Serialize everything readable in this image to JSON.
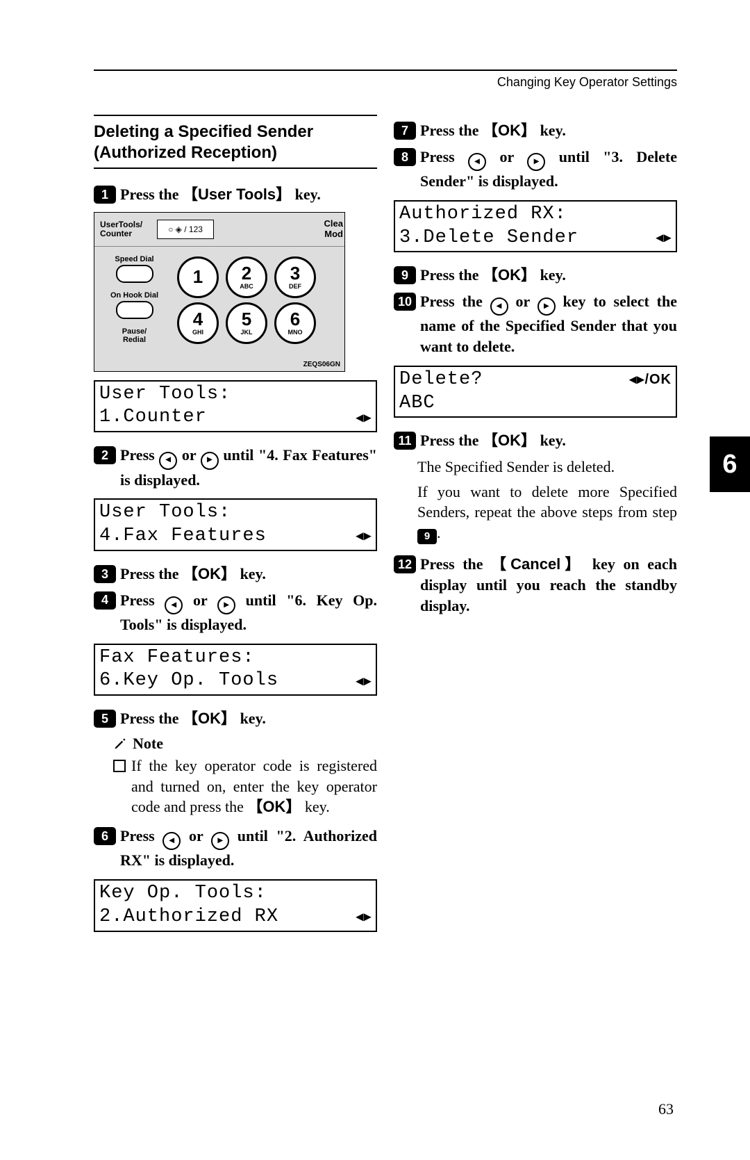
{
  "header": "Changing Key Operator Settings",
  "section_title": "Deleting a Specified Sender (Authorized Reception)",
  "page_number": "63",
  "tab_number": "6",
  "keys": {
    "user_tools": "User Tools",
    "ok": "OK",
    "cancel": "Cancel"
  },
  "keypad": {
    "label_top": "UserTools/\nCounter",
    "disp_glyphs": "○ ◈ / 123",
    "clea": "Clea",
    "mod": "Mod",
    "left": [
      "Speed Dial",
      "On Hook Dial",
      "Pause/\nRedial"
    ],
    "keys": [
      {
        "d": "1",
        "l": ""
      },
      {
        "d": "2",
        "l": "ABC"
      },
      {
        "d": "3",
        "l": "DEF"
      },
      {
        "d": "4",
        "l": "GHI"
      },
      {
        "d": "5",
        "l": "JKL"
      },
      {
        "d": "6",
        "l": "MNO"
      }
    ],
    "ref": "ZEQS06GN"
  },
  "lcd": {
    "s1": {
      "l1": "User Tools:",
      "l2": "1.Counter"
    },
    "s2": {
      "l1": "User Tools:",
      "l2": "4.Fax Features"
    },
    "s4": {
      "l1": "Fax Features:",
      "l2": "6.Key Op. Tools"
    },
    "s6": {
      "l1": "Key Op. Tools:",
      "l2": "2.Authorized RX"
    },
    "s8": {
      "l1": "Authorized RX:",
      "l2": "3.Delete Sender"
    },
    "s10": {
      "l1": "Delete?",
      "r1": "◂▸/OK",
      "l2": "ABC"
    }
  },
  "steps": {
    "n1": "1",
    "t1_a": "Press the ",
    "t1_c": " key.",
    "n2": "2",
    "t2": "Press 0 or 1 until \"4. Fax Features\" is displayed.",
    "n3": "3",
    "t3_a": "Press the ",
    "t3_c": " key.",
    "n4": "4",
    "t4": "Press 0 or 1 until \"6. Key Op. Tools\" is displayed.",
    "n5": "5",
    "t5_a": "Press the ",
    "t5_c": " key.",
    "n6": "6",
    "t6": "Press 0 or 1 until \"2. Authorized RX\" is displayed.",
    "n7": "7",
    "t7_a": "Press the ",
    "t7_c": " key.",
    "n8": "8",
    "t8": "Press 0 or 1 until \"3. Delete Sender\" is displayed.",
    "n9": "9",
    "t9_a": "Press the ",
    "t9_c": " key.",
    "n10": "10",
    "t10": "Press the 0 or 1 key to select the name of the Specified Sender that you want to delete.",
    "n11": "11",
    "t11_a": "Press the ",
    "t11_c": " key.",
    "t11f1": "The Specified Sender is deleted.",
    "t11f2_a": "If you want to delete more Specified Senders, repeat the above steps from step ",
    "t11f2_b": "9",
    "t11f2_c": ".",
    "n12": "12",
    "t12_a": "Press the ",
    "t12_c": " key on each display until you reach the standby display."
  },
  "note": {
    "head": "Note",
    "body_a": "If the key operator code is registered and turned on, enter the key operator code and press the ",
    "body_c": " key."
  }
}
